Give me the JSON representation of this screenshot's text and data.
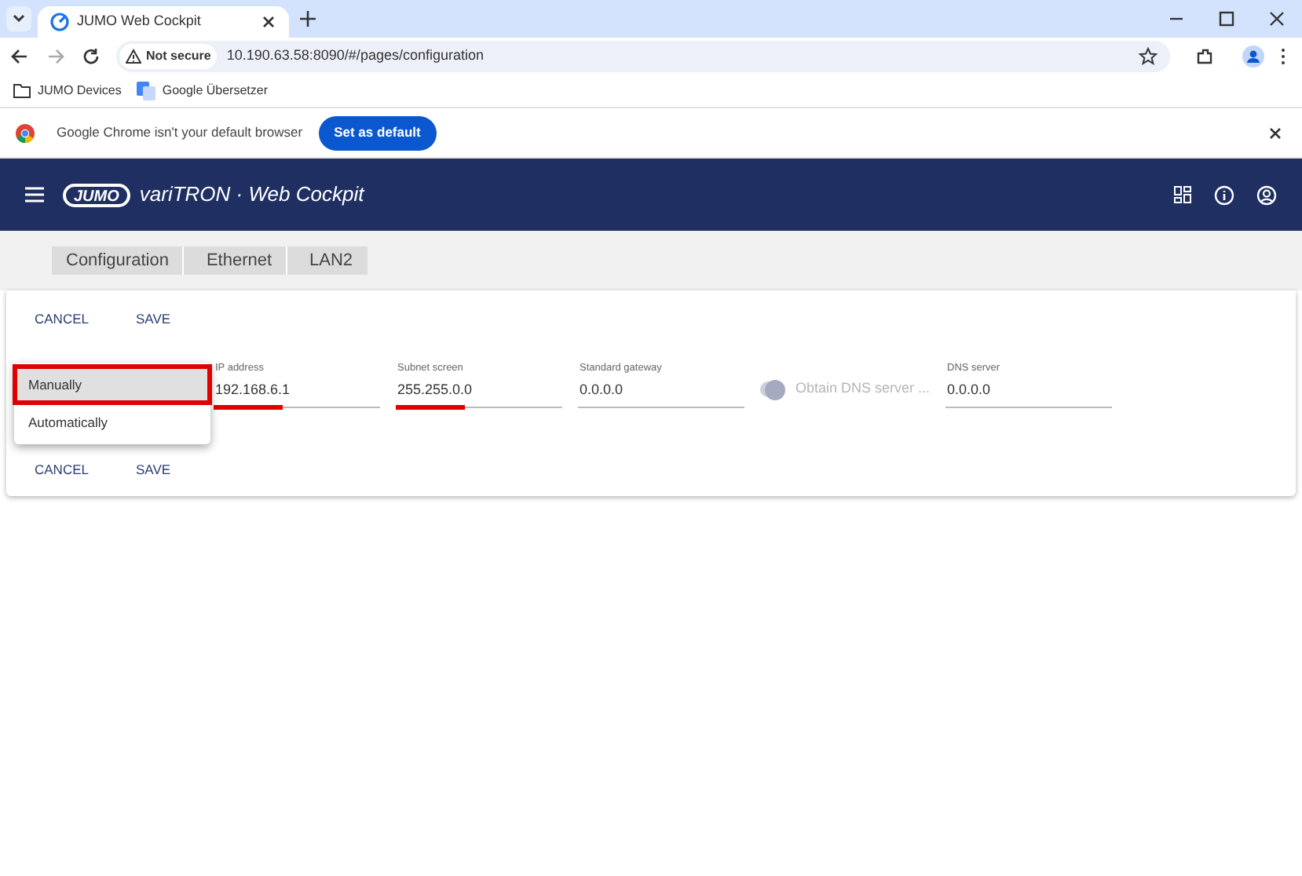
{
  "browser": {
    "tab": {
      "title": "JUMO Web Cockpit"
    },
    "security": "Not secure",
    "url": "10.190.63.58:8090/#/pages/configuration",
    "bookmarks": [
      {
        "label": "JUMO Devices",
        "kind": "folder"
      },
      {
        "label": "Google Übersetzer",
        "kind": "translate"
      }
    ],
    "infobar": {
      "message": "Google Chrome isn't your default browser",
      "button": "Set as default"
    }
  },
  "app": {
    "logo": "JUMO",
    "title": "variTRON · Web Cockpit"
  },
  "breadcrumb": [
    "Configuration",
    "Ethernet",
    "LAN2"
  ],
  "actions_top": [
    "CANCEL",
    "SAVE"
  ],
  "method_menu": [
    {
      "label": "Manually",
      "selected": true,
      "highlighted": true
    },
    {
      "label": "Automatically",
      "selected": false,
      "highlighted": false
    }
  ],
  "fields": [
    {
      "kind": "text",
      "label": "IP address",
      "value": "192.168.6.1",
      "highlighted": true
    },
    {
      "kind": "text",
      "label": "Subnet screen",
      "value": "255.255.0.0",
      "highlighted": true
    },
    {
      "kind": "text",
      "label": "Standard gateway",
      "value": "0.0.0.0",
      "highlighted": false
    },
    {
      "kind": "toggle",
      "label": "Obtain DNS server ...",
      "on": true,
      "disabled": true
    },
    {
      "kind": "text",
      "label": "DNS server",
      "value": "0.0.0.0",
      "highlighted": false
    }
  ],
  "actions_bottom": [
    "CANCEL",
    "SAVE"
  ]
}
